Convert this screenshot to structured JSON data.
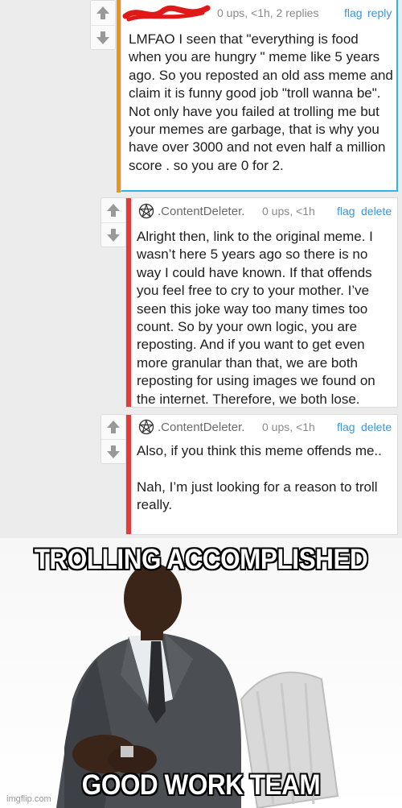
{
  "comments": [
    {
      "meta": "0 ups, <1h, 2 replies",
      "actions": [
        "flag",
        "reply"
      ],
      "text": "LMFAO I seen that \"everything is food when you are hungry \" meme like 5 years ago. So you reposted an old ass meme and claim it is funny good job \"troll wanna be\". Not only have you failed at trolling me but your memes are garbage, that is why you have over 3000 and not even half a million score . so you are 0 for 2."
    },
    {
      "author": ".ContentDeleter.",
      "meta": "0 ups, <1h",
      "actions": [
        "flag",
        "delete"
      ],
      "text": "Alright then, link to the original meme. I wasn’t here 5 years ago so there is no way I could have known. If that offends you feel free to cry to your mother. I’ve seen this joke way too many times too count. So by your own logic, you are reposting. And if you want to get even more granular than that, we are both reposting for using images we found on the internet. Therefore, we both lose."
    },
    {
      "author": ".ContentDeleter.",
      "meta": "0 ups, <1h",
      "actions": [
        "flag",
        "delete"
      ],
      "text_lines": [
        "Also, if you think this meme offends me..",
        "",
        "Nah, I’m just looking for a reason to troll really."
      ]
    }
  ],
  "meme": {
    "top_caption": "TROLLING ACCOMPLISHED",
    "bottom_caption": "GOOD WORK TEAM",
    "watermark": "imgflip.com"
  },
  "colors": {
    "op_stripe": "#e8941d",
    "op_border": "#29b6e8",
    "reply_stripe": "#e43a3a",
    "link": "#3b96d8"
  },
  "icons": [
    "upvote-arrow-icon",
    "downvote-arrow-icon",
    "pentagram-user-icon",
    "redaction-scribble"
  ]
}
